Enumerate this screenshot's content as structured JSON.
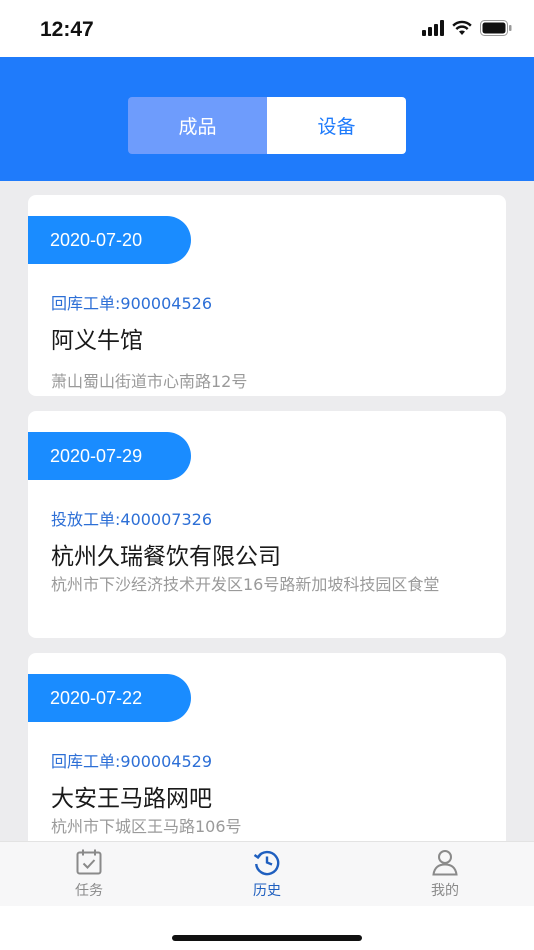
{
  "status_bar": {
    "time": "12:47"
  },
  "segment": {
    "tabs": [
      {
        "label": "成品"
      },
      {
        "label": "设备"
      }
    ],
    "active_index": 0
  },
  "records": [
    {
      "date": "2020-07-20",
      "order": "回库工单:900004526",
      "name": "阿义牛馆",
      "address": "萧山蜀山街道市心南路12号"
    },
    {
      "date": "2020-07-29",
      "order": "投放工单:400007326",
      "name": "杭州久瑞餐饮有限公司",
      "address": "杭州市下沙经济技术开发区16号路新加坡科技园区食堂"
    },
    {
      "date": "2020-07-22",
      "order": "回库工单:900004529",
      "name": "大安王马路网吧",
      "address": "杭州市下城区王马路106号"
    }
  ],
  "tab_bar": {
    "tabs": [
      {
        "label": "任务",
        "icon": "calendar-check-icon"
      },
      {
        "label": "历史",
        "icon": "history-icon"
      },
      {
        "label": "我的",
        "icon": "user-icon"
      }
    ],
    "active_index": 1
  },
  "colors": {
    "brand": "#1f7bfb",
    "tag": "#1a8cff",
    "order_text": "#2d6fd6"
  }
}
